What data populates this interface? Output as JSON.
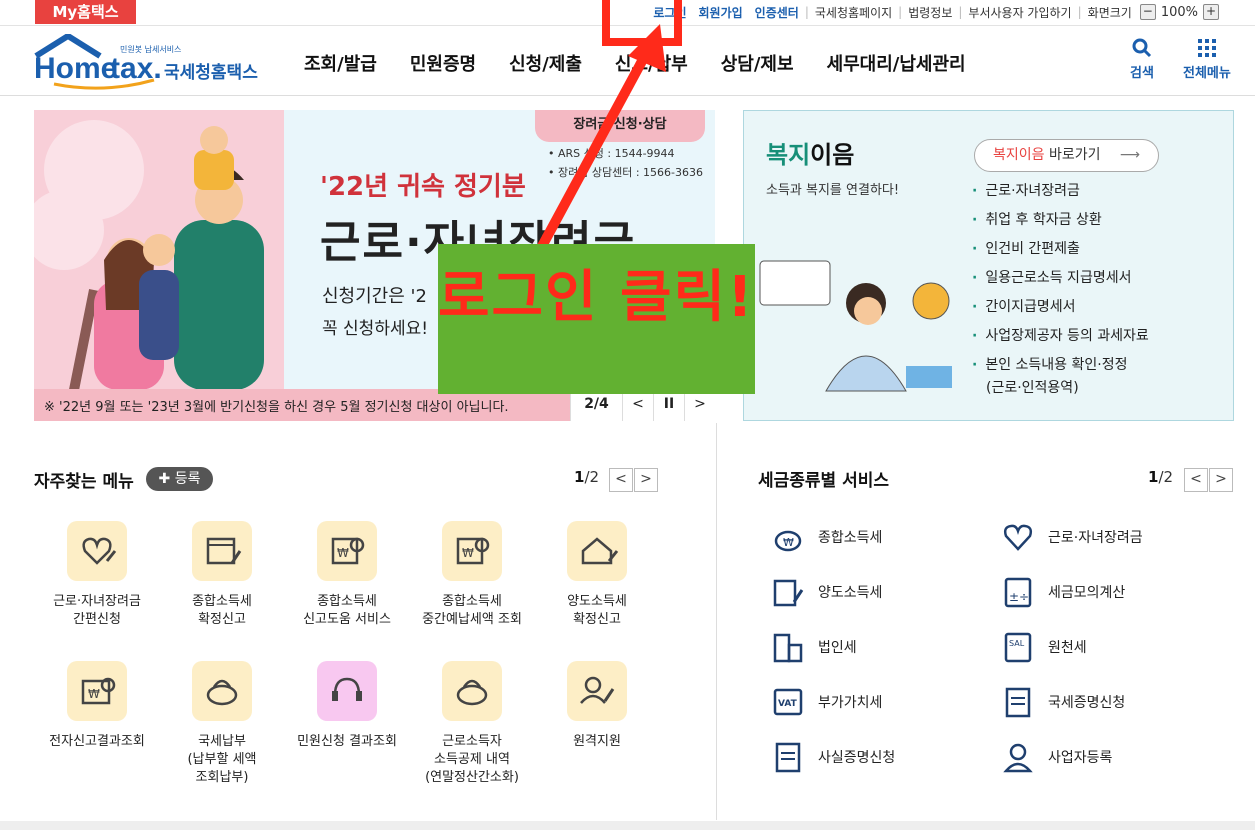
{
  "topbar": {
    "my_hometax": "My홈택스",
    "links": [
      "로그인",
      "회원가입",
      "인증센터",
      "국세청홈페이지",
      "법령정보",
      "부서사용자 가입하기",
      "화면크기"
    ],
    "zoom_minus": "−",
    "zoom_value": "100%",
    "zoom_plus": "+"
  },
  "header": {
    "logo_small": "민원봇 납세서비스",
    "logo_text": "Hometax.",
    "logo_kor": "국세청홈택스",
    "menu": [
      "조회/발급",
      "민원증명",
      "신청/제출",
      "신고/납부",
      "상담/제보",
      "세무대리/납세관리"
    ],
    "search_label": "검색",
    "allmenu_label": "전체메뉴"
  },
  "banner": {
    "tag": "장려금 신청·상담",
    "info1": "• ARS 신청 : 1544-9944",
    "info2": "• 장려금 상담센터 : 1566-3636",
    "subtitle": "'22년 귀속 정기분",
    "title": "근로·자녀장려금",
    "line1": "신청기간은 '2",
    "line2": "꼭 신청하세요!",
    "note": "※ '22년 9월 또는 '23년 3월에 반기신청을 하신 경우 5월 정기신청 대상이 아닙니다.",
    "page": "2/4",
    "prev": "<",
    "pause": "II",
    "next": ">"
  },
  "annotation": {
    "text": "로그인 클릭!",
    "color": "#ff2a1a"
  },
  "welfare": {
    "title_green": "복지",
    "title_rest": "이음",
    "subtitle": "소득과 복지를 연결하다!",
    "goto_red": "복지이음",
    "goto_rest": " 바로가기",
    "goto_arrow": "⟶",
    "items": [
      "근로·자녀장려금",
      "취업 후 학자금 상환",
      "인건비 간편제출",
      "일용근로소득 지급명세서",
      "간이지급명세서",
      "사업장제공자 등의 과세자료",
      "본인 소득내용 확인·정정"
    ],
    "item_cont": "(근로·인적용역)"
  },
  "favorites": {
    "title": "자주찾는 메뉴",
    "register": "✚ 등록",
    "page_cur": "1",
    "page_total": "/2",
    "prev": "<",
    "next": ">",
    "items": [
      {
        "l1": "근로·자녀장려금",
        "l2": "간편신청",
        "l3": ""
      },
      {
        "l1": "종합소득세",
        "l2": "확정신고",
        "l3": ""
      },
      {
        "l1": "종합소득세",
        "l2": "신고도움 서비스",
        "l3": ""
      },
      {
        "l1": "종합소득세",
        "l2": "중간예납세액 조회",
        "l3": ""
      },
      {
        "l1": "양도소득세",
        "l2": "확정신고",
        "l3": ""
      },
      {
        "l1": "전자신고결과조회",
        "l2": "",
        "l3": ""
      },
      {
        "l1": "국세납부",
        "l2": "(납부할 세액",
        "l3": "조회납부)"
      },
      {
        "l1": "민원신청 결과조회",
        "l2": "",
        "l3": ""
      },
      {
        "l1": "근로소득자",
        "l2": "소득공제 내역",
        "l3": "(연말정산간소화)"
      },
      {
        "l1": "원격지원",
        "l2": "",
        "l3": ""
      }
    ]
  },
  "tax_services": {
    "title": "세금종류별 서비스",
    "page_cur": "1",
    "page_total": "/2",
    "prev": "<",
    "next": ">",
    "items": [
      "종합소득세",
      "근로·자녀장려금",
      "양도소득세",
      "세금모의계산",
      "법인세",
      "원천세",
      "부가가치세",
      "국세증명신청",
      "사실증명신청",
      "사업자등록"
    ]
  },
  "colors": {
    "accent": "#1b5fae",
    "brand_red": "#e8423f",
    "teal": "#168f78"
  }
}
